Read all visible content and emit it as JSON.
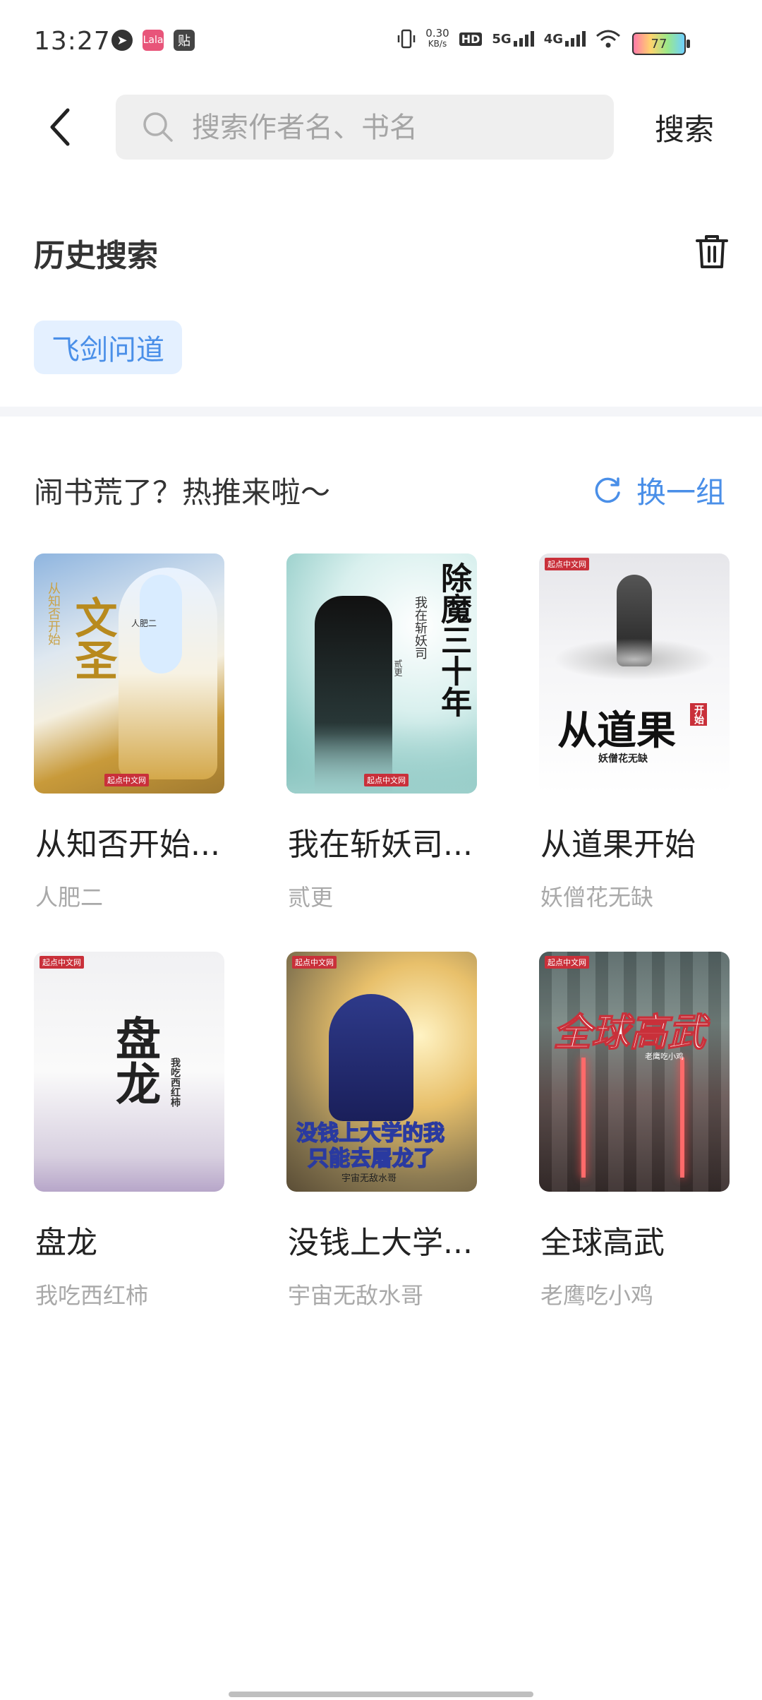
{
  "status_bar": {
    "time": "13:27",
    "net_speed_value": "0.30",
    "net_speed_unit": "KB/s",
    "hd_label": "HD",
    "sim1_label": "5G",
    "sim2_label": "4G",
    "battery": "77",
    "icon_labels": {
      "pink_app": "Lala",
      "tie_app": "贴"
    }
  },
  "search": {
    "placeholder": "搜索作者名、书名",
    "value": "",
    "button_label": "搜索"
  },
  "history": {
    "title": "历史搜索",
    "tags": [
      "飞剑问道"
    ]
  },
  "recommend": {
    "title": "闹书荒了？热推来啦～",
    "refresh_label": "换一组",
    "books": [
      {
        "title": "从知否开始...",
        "author": "人肥二",
        "cover_text": "文圣",
        "cover_sub": "从知否开始",
        "cover_author": "人肥二"
      },
      {
        "title": "我在斩妖司...",
        "author": "贰更",
        "cover_text": "除魔三十年",
        "cover_sub": "我在斩妖司",
        "cover_author": "贰更"
      },
      {
        "title": "从道果开始",
        "author": "妖僧花无缺",
        "cover_text": "从道果",
        "cover_sub": "开始",
        "cover_author": "妖僧花无缺"
      },
      {
        "title": "盘龙",
        "author": "我吃西红柿",
        "cover_text": "盘龙",
        "cover_sub": "",
        "cover_author": "我吃西红柿"
      },
      {
        "title": "没钱上大学...",
        "author": "宇宙无敌水哥",
        "cover_text": "没钱上大学的我",
        "cover_sub": "只能去屠龙了",
        "cover_author": "宇宙无敌水哥"
      },
      {
        "title": "全球高武",
        "author": "老鹰吃小鸡",
        "cover_text": "全球高武",
        "cover_sub": "",
        "cover_author": "老鹰吃小鸡"
      }
    ],
    "publisher_badge": "起点中文网"
  },
  "colors": {
    "accent": "#4a8fe8",
    "tag_bg": "#e4f0ff",
    "search_bg": "#efefef"
  }
}
